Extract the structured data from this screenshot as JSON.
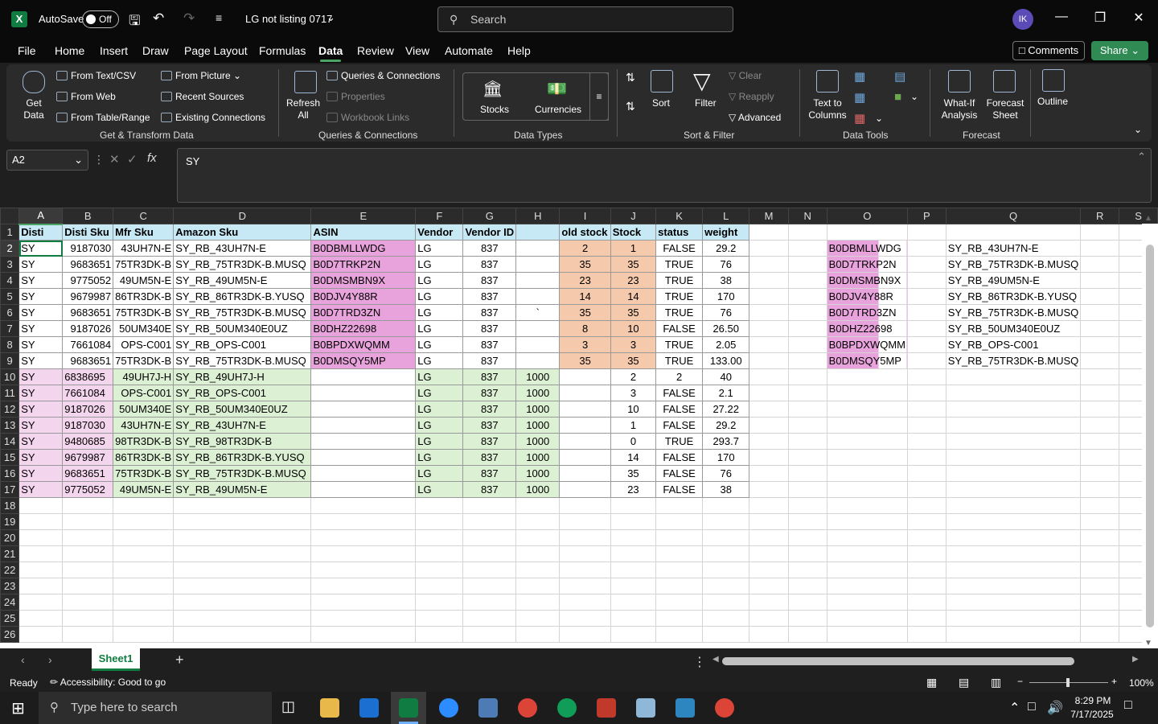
{
  "titlebar": {
    "autosave_label": "AutoSave",
    "autosave_state": "Off",
    "filename": "LG not listing 0717",
    "search_placeholder": "Search",
    "avatar_initials": "IK"
  },
  "menu": [
    "File",
    "Home",
    "Insert",
    "Draw",
    "Page Layout",
    "Formulas",
    "Data",
    "Review",
    "View",
    "Automate",
    "Help"
  ],
  "menu_active": "Data",
  "buttons": {
    "comments": "Comments",
    "share": "Share"
  },
  "ribbon": {
    "get_data": "Get Data",
    "from_text_csv": "From Text/CSV",
    "from_web": "From Web",
    "from_table_range": "From Table/Range",
    "from_picture": "From Picture",
    "recent_sources": "Recent Sources",
    "existing_connections": "Existing Connections",
    "group_get_transform": "Get & Transform Data",
    "refresh_all": "Refresh All",
    "queries_connections": "Queries & Connections",
    "properties": "Properties",
    "workbook_links": "Workbook Links",
    "group_queries": "Queries & Connections",
    "stocks": "Stocks",
    "currencies": "Currencies",
    "group_data_types": "Data Types",
    "sort": "Sort",
    "filter": "Filter",
    "clear": "Clear",
    "reapply": "Reapply",
    "advanced": "Advanced",
    "group_sort_filter": "Sort & Filter",
    "text_to_columns": "Text to Columns",
    "group_data_tools": "Data Tools",
    "what_if": "What-If Analysis",
    "forecast_sheet": "Forecast Sheet",
    "group_forecast": "Forecast",
    "outline": "Outline"
  },
  "formula_bar": {
    "name_box": "A2",
    "formula": "SY"
  },
  "columns": [
    "A",
    "B",
    "C",
    "D",
    "E",
    "F",
    "G",
    "H",
    "I",
    "J",
    "K",
    "L",
    "M",
    "N",
    "O",
    "P",
    "Q",
    "R",
    "S"
  ],
  "header_row": [
    "Disti",
    "Disti Sku",
    "Mfr Sku",
    "Amazon Sku",
    "ASIN",
    "Vendor",
    "Vendor ID",
    "",
    "old stock",
    "Stock",
    "status",
    "weight"
  ],
  "rows": [
    [
      "SY",
      "9187030",
      "43UH7N-E",
      "SY_RB_43UH7N-E",
      "B0DBMLLWDG",
      "LG",
      "837",
      "",
      "2",
      "1",
      "FALSE",
      "29.2"
    ],
    [
      "SY",
      "9683651",
      "75TR3DK-B",
      "SY_RB_75TR3DK-B.MUSQ",
      "B0D7TRKP2N",
      "LG",
      "837",
      "",
      "35",
      "35",
      "TRUE",
      "76"
    ],
    [
      "SY",
      "9775052",
      "49UM5N-E",
      "SY_RB_49UM5N-E",
      "B0DMSMBN9X",
      "LG",
      "837",
      "",
      "23",
      "23",
      "TRUE",
      "38"
    ],
    [
      "SY",
      "9679987",
      "86TR3DK-B",
      "SY_RB_86TR3DK-B.YUSQ",
      "B0DJV4Y88R",
      "LG",
      "837",
      "",
      "14",
      "14",
      "TRUE",
      "170"
    ],
    [
      "SY",
      "9683651",
      "75TR3DK-B",
      "SY_RB_75TR3DK-B.MUSQ",
      "B0D7TRD3ZN",
      "LG",
      "837",
      "`",
      "35",
      "35",
      "TRUE",
      "76"
    ],
    [
      "SY",
      "9187026",
      "50UM340E",
      "SY_RB_50UM340E0UZ",
      "B0DHZ22698",
      "LG",
      "837",
      "",
      "8",
      "10",
      "FALSE",
      "26.50"
    ],
    [
      "SY",
      "7661084",
      "OPS-C001",
      "SY_RB_OPS-C001",
      "B0BPDXWQMM",
      "LG",
      "837",
      "",
      "3",
      "3",
      "TRUE",
      "2.05"
    ],
    [
      "SY",
      "9683651",
      "75TR3DK-B",
      "SY_RB_75TR3DK-B.MUSQ",
      "B0DMSQY5MP",
      "LG",
      "837",
      "",
      "35",
      "35",
      "TRUE",
      "133.00"
    ],
    [
      "SY",
      "6838695",
      "49UH7J-H",
      "SY_RB_49UH7J-H",
      "",
      "LG",
      "837",
      "1000",
      "",
      "2",
      "2",
      "40"
    ],
    [
      "SY",
      "7661084",
      "OPS-C001",
      "SY_RB_OPS-C001",
      "",
      "LG",
      "837",
      "1000",
      "",
      "3",
      "FALSE",
      "2.1"
    ],
    [
      "SY",
      "9187026",
      "50UM340E",
      "SY_RB_50UM340E0UZ",
      "",
      "LG",
      "837",
      "1000",
      "",
      "10",
      "FALSE",
      "27.22"
    ],
    [
      "SY",
      "9187030",
      "43UH7N-E",
      "SY_RB_43UH7N-E",
      "",
      "LG",
      "837",
      "1000",
      "",
      "1",
      "FALSE",
      "29.2"
    ],
    [
      "SY",
      "9480685",
      "98TR3DK-B",
      "SY_RB_98TR3DK-B",
      "",
      "LG",
      "837",
      "1000",
      "",
      "0",
      "TRUE",
      "293.7"
    ],
    [
      "SY",
      "9679987",
      "86TR3DK-B",
      "SY_RB_86TR3DK-B.YUSQ",
      "",
      "LG",
      "837",
      "1000",
      "",
      "14",
      "FALSE",
      "170"
    ],
    [
      "SY",
      "9683651",
      "75TR3DK-B",
      "SY_RB_75TR3DK-B.MUSQ",
      "",
      "LG",
      "837",
      "1000",
      "",
      "35",
      "FALSE",
      "76"
    ],
    [
      "SY",
      "9775052",
      "49UM5N-E",
      "SY_RB_49UM5N-E",
      "",
      "LG",
      "837",
      "1000",
      "",
      "23",
      "FALSE",
      "38"
    ]
  ],
  "side_o": [
    "B0DBMLLWDG",
    "B0D7TRKP2N",
    "B0DMSMBN9X",
    "B0DJV4Y88R",
    "B0D7TRD3ZN",
    "B0DHZ22698",
    "B0BPDXWQMM",
    "B0DMSQY5MP"
  ],
  "side_q": [
    "SY_RB_43UH7N-E",
    "SY_RB_75TR3DK-B.MUSQ",
    "SY_RB_49UM5N-E",
    "SY_RB_86TR3DK-B.YUSQ",
    "SY_RB_75TR3DK-B.MUSQ",
    "SY_RB_50UM340E0UZ",
    "SY_RB_OPS-C001",
    "SY_RB_75TR3DK-B.MUSQ"
  ],
  "row_numbers": 26,
  "sheet": {
    "tab": "Sheet1",
    "add": "+"
  },
  "status": {
    "ready": "Ready",
    "accessibility": "Accessibility: Good to go",
    "zoom": "100%"
  },
  "taskbar": {
    "search": "Type here to search",
    "time": "8:29 PM",
    "date": "7/17/2025"
  },
  "colors": {
    "excel_green": "#107c41",
    "asin_pink": "#e8a3dc",
    "header_blue": "#c6e9f5",
    "row_green": "#dcf0d4",
    "stock_orange": "#f5c9ab"
  }
}
